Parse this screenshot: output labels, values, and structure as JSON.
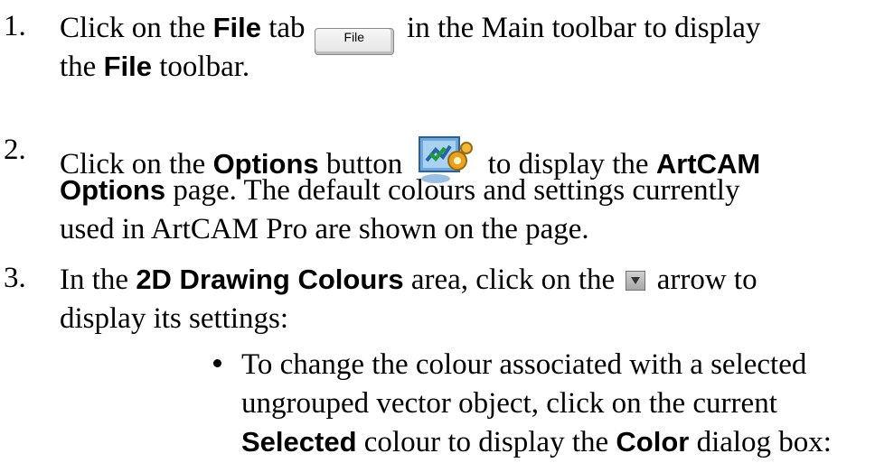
{
  "steps": [
    {
      "number": "1.",
      "lines": [
        {
          "pre": "Click on the ",
          "bold": "File",
          "mid": " tab ",
          "post": " in the Main toolbar to display"
        },
        {
          "pre": "the ",
          "bold": "File",
          "post": " toolbar."
        }
      ],
      "tab_label": "File"
    },
    {
      "number": "2.",
      "lines": [
        {
          "pre": "Click on the ",
          "bold": "Options",
          "mid": " button ",
          "post": " to display the ",
          "bold2": "ArtCAM"
        },
        {
          "bold": "Options",
          "post": " page. The default colours and settings currently"
        },
        {
          "pre": "used in ArtCAM Pro are shown on the page."
        }
      ],
      "icon": "options-icon"
    },
    {
      "number": "3.",
      "lines": [
        {
          "pre": "In the ",
          "bold": "2D Drawing Colours",
          "mid": " area, click on the ",
          "post": " arrow to"
        },
        {
          "pre": "display its settings:"
        }
      ],
      "icon": "dropdown-arrow-icon"
    }
  ],
  "bullet": {
    "lines": [
      {
        "pre": "To change the colour associated with a selected"
      },
      {
        "pre": "ungrouped vector object, click on the current"
      },
      {
        "bold": "Selected",
        "mid": " colour to display the ",
        "bold2": "Color",
        "post": " dialog box:"
      }
    ]
  }
}
